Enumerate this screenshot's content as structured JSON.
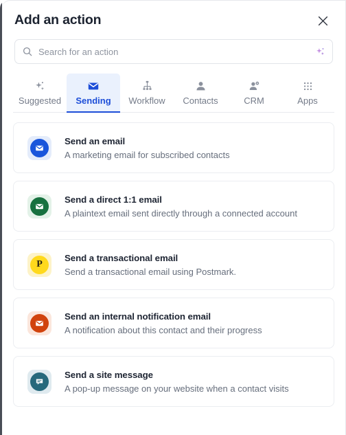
{
  "panel": {
    "title": "Add an action",
    "close_label": "×"
  },
  "search": {
    "placeholder": "Search for an action",
    "value": "",
    "icon": "search-icon",
    "ai_icon": "sparkle-icon",
    "ai_icon_color": "#b07fd6"
  },
  "tabs": [
    {
      "label": "Suggested",
      "icon": "sparkle-icon",
      "active": false
    },
    {
      "label": "Sending",
      "icon": "envelope-icon",
      "active": true
    },
    {
      "label": "Workflow",
      "icon": "sitemap-icon",
      "active": false
    },
    {
      "label": "Contacts",
      "icon": "person-icon",
      "active": false
    },
    {
      "label": "CRM",
      "icon": "person-gear-icon",
      "active": false
    },
    {
      "label": "Apps",
      "icon": "grid-dots-icon",
      "active": false
    }
  ],
  "active_tab_color": "#1d4ed8",
  "active_tab_bg": "#eaf1fd",
  "actions": [
    {
      "title": "Send an email",
      "description": "A marketing email for subscribed contacts",
      "icon": "envelope-icon",
      "icon_color": "#1a56db",
      "icon_bg": "#e4ecfb"
    },
    {
      "title": "Send a direct 1:1 email",
      "description": "A plaintext email sent directly through a connected account",
      "icon": "envelope-icon",
      "icon_color": "#17713f",
      "icon_bg": "#e3f2e8"
    },
    {
      "title": "Send a transactional email",
      "description": "Send a transactional email using Postmark.",
      "icon": "postmark-p-icon",
      "icon_color": "#ffd91c",
      "icon_bg": "#fdf3c8",
      "icon_letter": "P"
    },
    {
      "title": "Send an internal notification email",
      "description": "A notification about this contact and their progress",
      "icon": "envelope-icon",
      "icon_color": "#d1430d",
      "icon_bg": "#fbe6dc"
    },
    {
      "title": "Send a site message",
      "description": "A pop-up message on your website when a contact visits",
      "icon": "chat-bubble-icon",
      "icon_color": "#27697c",
      "icon_bg": "#dfeaef"
    }
  ]
}
